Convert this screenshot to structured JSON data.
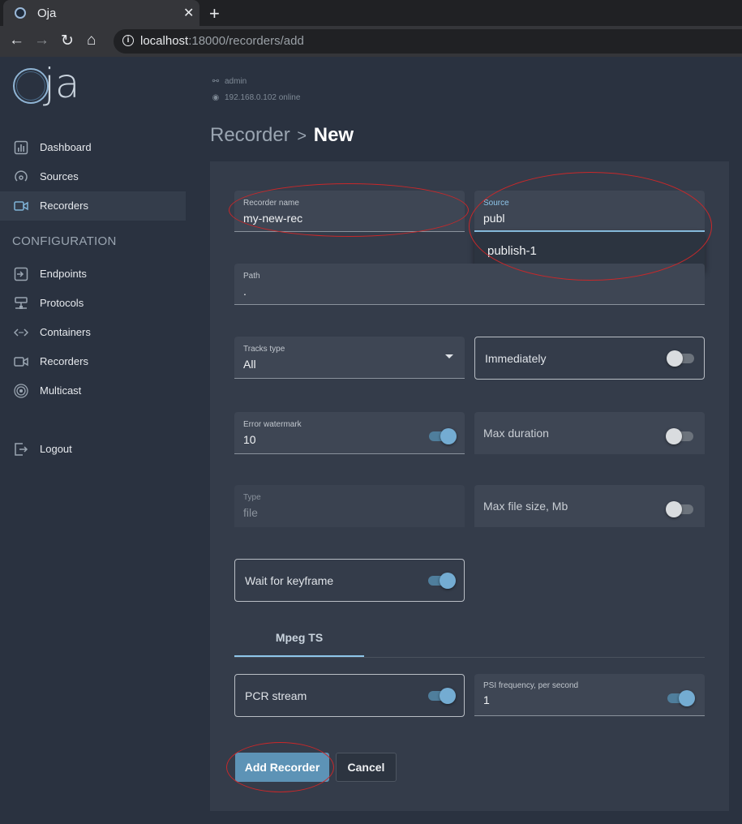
{
  "browser": {
    "tab_title": "Oja",
    "close_glyph": "✕",
    "new_tab_glyph": "+",
    "url_host": "localhost",
    "url_rest": ":18000/recorders/add",
    "info_glyph": "i"
  },
  "sidebar": {
    "logo_text": "ja",
    "items": [
      {
        "label": "Dashboard",
        "icon": "chart-bar-icon"
      },
      {
        "label": "Sources",
        "icon": "signal-icon"
      },
      {
        "label": "Recorders",
        "icon": "video-camera-icon"
      }
    ],
    "section_label": "CONFIGURATION",
    "config_items": [
      {
        "label": "Endpoints",
        "icon": "login-box-icon"
      },
      {
        "label": "Protocols",
        "icon": "network-icon"
      },
      {
        "label": "Containers",
        "icon": "code-arrows-icon"
      },
      {
        "label": "Recorders",
        "icon": "video-camera-icon"
      },
      {
        "label": "Multicast",
        "icon": "broadcast-icon"
      }
    ],
    "logout_label": "Logout"
  },
  "header": {
    "user": "admin",
    "server_status": "192.168.0.102 online",
    "breadcrumb_parent": "Recorder",
    "breadcrumb_sep": ">",
    "breadcrumb_current": "New"
  },
  "form": {
    "recorder_name": {
      "label": "Recorder name",
      "value": "my-new-rec"
    },
    "source": {
      "label": "Source",
      "value": "publ",
      "suggestion": "publish-1"
    },
    "path": {
      "label": "Path",
      "value": "."
    },
    "tracks_type": {
      "label": "Tracks type",
      "value": "All"
    },
    "immediately": {
      "label": "Immediately",
      "on": false
    },
    "error_watermark": {
      "label": "Error watermark",
      "value": "10",
      "on": true
    },
    "max_duration": {
      "label": "Max duration",
      "on": false
    },
    "type": {
      "label": "Type",
      "value": "file"
    },
    "max_file_size": {
      "label": "Max file size, Mb",
      "on": false
    },
    "wait_for_keyframe": {
      "label": "Wait for keyframe",
      "on": true
    },
    "tab_label": "Mpeg TS",
    "pcr_stream": {
      "label": "PCR stream",
      "on": true
    },
    "psi_frequency": {
      "label": "PSI frequency, per second",
      "value": "1",
      "on": true
    },
    "add_button": "Add Recorder",
    "cancel_button": "Cancel"
  },
  "colors": {
    "background": "#2a3240",
    "panel": "#343c4a",
    "accent": "#5d93b6",
    "annotation": "#c8282a"
  }
}
